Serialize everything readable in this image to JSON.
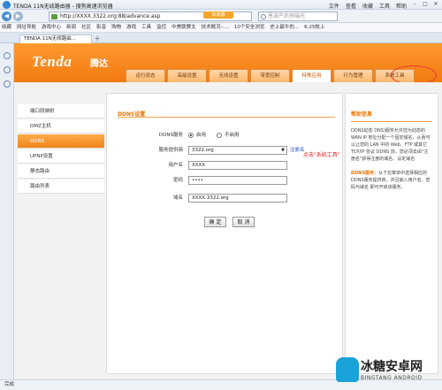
{
  "browser": {
    "window_title": "TENDA 11N无线路由器 - 搜狗高速浏览器",
    "menu": [
      "文件",
      "查看",
      "收藏",
      "工具",
      "帮助"
    ],
    "url": "http://XXXX.3322.org:88/advance.asp",
    "accelerate_label": "加速器",
    "search_placeholder": "恩波产后预瑞光",
    "favorites": [
      "收藏",
      "网址导航",
      "游戏中心",
      "新闻",
      "社区",
      "影音",
      "购物",
      "游戏",
      "工具",
      "监控",
      "中美联赛太",
      "技术概况--...",
      "10个安全浏览",
      "史上最牛的...",
      "6.25枚上"
    ],
    "tab_title": "TENDA 11N无线路由...",
    "status_text": "完成"
  },
  "router": {
    "brand": "Tenda",
    "brand_cn": "腾达",
    "top_nav": [
      {
        "label": "运行状态",
        "active": false
      },
      {
        "label": "高级设置",
        "active": false
      },
      {
        "label": "无线设置",
        "active": false
      },
      {
        "label": "带宽控制",
        "active": false
      },
      {
        "label": "特殊应用",
        "active": true
      },
      {
        "label": "行为管理",
        "active": false
      },
      {
        "label": "系统工具",
        "active": false
      }
    ],
    "left_menu": [
      {
        "label": "端口段映射",
        "active": false
      },
      {
        "label": "DMZ主机",
        "active": false
      },
      {
        "label": "DDNS",
        "active": true
      },
      {
        "label": "UPNP设置",
        "active": false
      },
      {
        "label": "静态路由",
        "active": false
      },
      {
        "label": "路由列表",
        "active": false
      }
    ],
    "section_title": "DDNS设置",
    "form": {
      "ddns_service_label": "DDNS服务",
      "enable_label": "启用",
      "disable_label": "不启用",
      "enabled": true,
      "provider_label": "服务提供商",
      "provider_value": "3322.org",
      "register_link": "注册名",
      "username_label": "用户名",
      "username_value": "XXXX",
      "password_label": "密码",
      "password_value": "••••",
      "domain_label": "域名",
      "domain_value": "XXXX.3322.org",
      "ok_button": "确 定",
      "cancel_button": "取 消"
    },
    "annotation": "点击\"系统工具\"",
    "help": {
      "title": "帮助信息",
      "para1": "DDNS动态 DNS)服务允许您为动态的 WAN IP 地址分配一个固定域名，从而可以让您的 LAN 中的 Web、FTP 或其它 TCP/IP 协议 DDNS 前，您必须去由\"注册名\"获得注册的域名、设定域名",
      "para2_bold": "DDNS服务：",
      "para2": "从下拉菜单中选择相应的DDNS服务提供商，并且输入用户名、密码与域名 即可开启该服务。"
    }
  },
  "watermark": {
    "cn": "冰糖安卓网",
    "en": "BINGTANG ANDROID"
  }
}
